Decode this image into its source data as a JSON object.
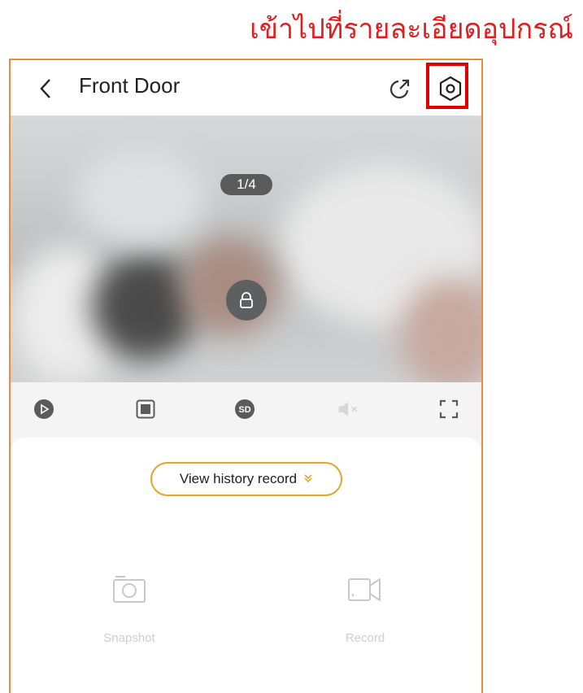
{
  "annotation": {
    "text": "เข้าไปที่รายละเอียดอุปกรณ์",
    "color": "#e01e1e"
  },
  "header": {
    "back_icon": "chevron-left-icon",
    "title": "Front Door",
    "share_icon": "share-icon",
    "settings_icon": "settings-icon"
  },
  "video": {
    "page_indicator": "1/4",
    "lock_icon": "lock-icon"
  },
  "controls": [
    {
      "name": "play-icon"
    },
    {
      "name": "stop-icon"
    },
    {
      "name": "sd-quality-icon",
      "text": "SD"
    },
    {
      "name": "mute-icon"
    },
    {
      "name": "fullscreen-icon"
    }
  ],
  "history": {
    "label": "View history record",
    "chevron": "»"
  },
  "actions": {
    "snapshot": {
      "label": "Snapshot",
      "icon": "camera-icon"
    },
    "record": {
      "label": "Record",
      "icon": "video-record-icon"
    }
  },
  "colors": {
    "frame": "#f08a3e",
    "accent": "#e3a52a",
    "highlight": "#e00000"
  }
}
